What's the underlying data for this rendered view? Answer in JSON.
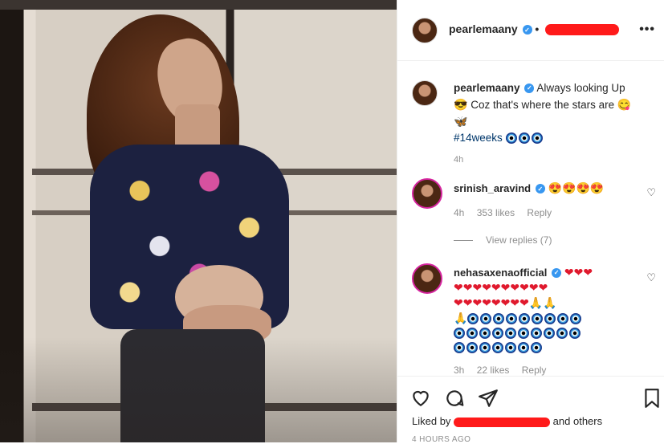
{
  "post": {
    "author": "pearlemaany",
    "caption_text": "Always looking Up",
    "caption_line2": "Coz that's where the stars are",
    "hashtag": "#14weeks",
    "caption_time": "4h"
  },
  "comments": [
    {
      "user": "srinish_aravind",
      "time": "4h",
      "likes": "353 likes",
      "reply": "Reply"
    },
    {
      "user": "nehasaxenaofficial",
      "time": "3h",
      "likes": "22 likes",
      "reply": "Reply"
    }
  ],
  "view_replies": "View replies (7)",
  "footer": {
    "liked_by_prefix": "Liked by",
    "liked_by_suffix": "and others",
    "time_ago": "4 HOURS AGO"
  },
  "colors": {
    "verified": "#3897f0",
    "redaction": "#ff1a1a",
    "hashtag": "#00376b"
  }
}
